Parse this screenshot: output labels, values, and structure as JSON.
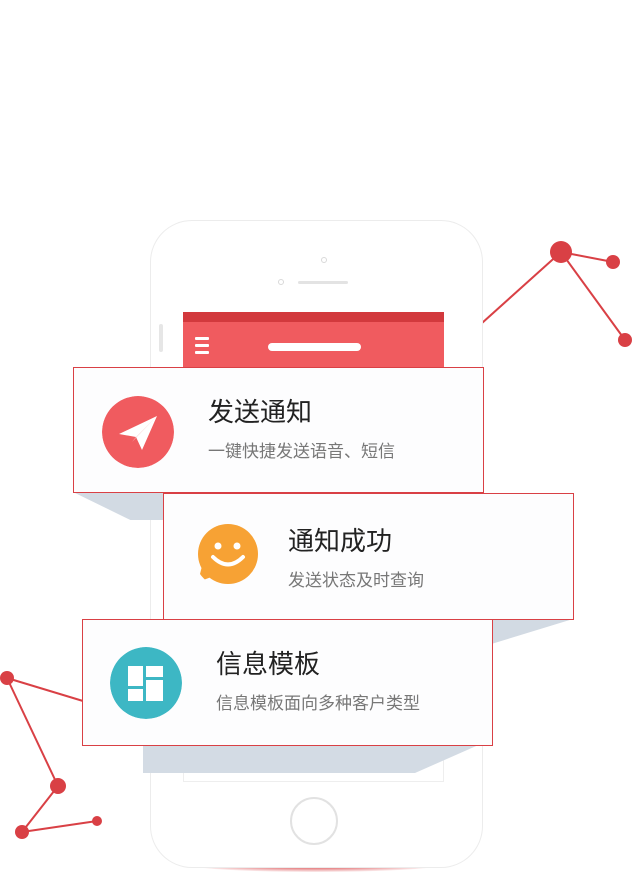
{
  "colors": {
    "accent_red": "#f05b5f",
    "dark_red": "#d2393d",
    "orange": "#f7a234",
    "teal": "#3db7c4",
    "card_border": "#d94045",
    "shadow_gray": "#d3dbe4"
  },
  "cards": [
    {
      "title": "发送通知",
      "subtitle": "一键快捷发送语音、短信",
      "icon": "paper-plane-icon"
    },
    {
      "title": "通知成功",
      "subtitle": "发送状态及时查询",
      "icon": "smiley-chat-icon"
    },
    {
      "title": "信息模板",
      "subtitle": "信息模板面向多种客户类型",
      "icon": "template-grid-icon"
    }
  ]
}
